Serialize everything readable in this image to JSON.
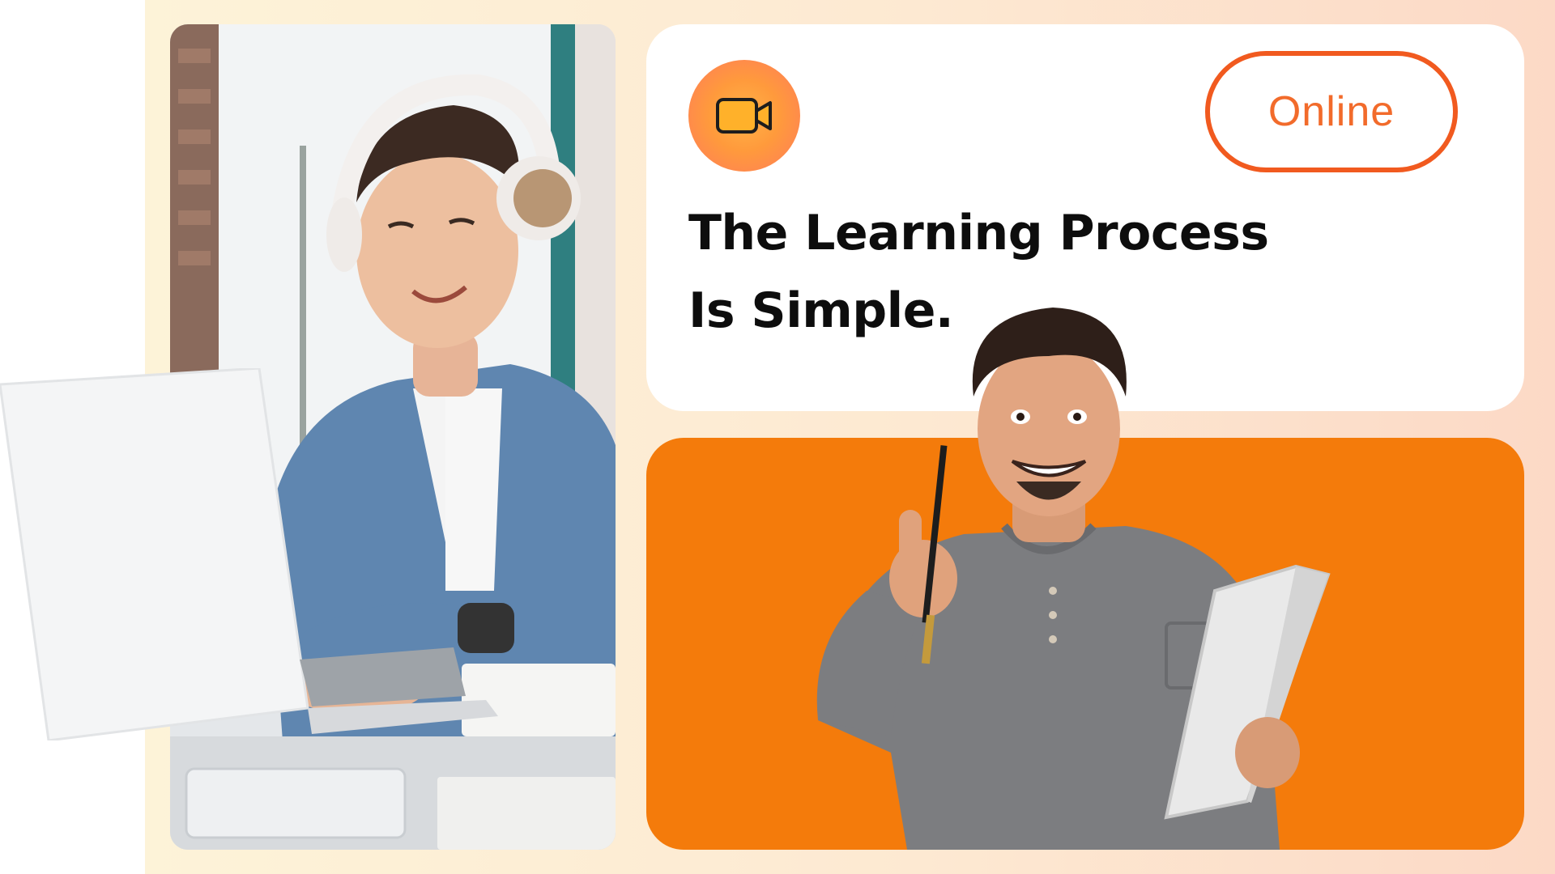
{
  "status": {
    "label": "Online"
  },
  "headline": {
    "line1": "The Learning Process",
    "line2": "Is Simple."
  },
  "icons": {
    "video": "video-camera-icon"
  },
  "colors": {
    "accent": "#f47b0b",
    "pill_border": "#f15a1f",
    "pill_text": "#f26b2b",
    "background_warm": "#fde9d2",
    "headline_text": "#0d0d0d"
  }
}
